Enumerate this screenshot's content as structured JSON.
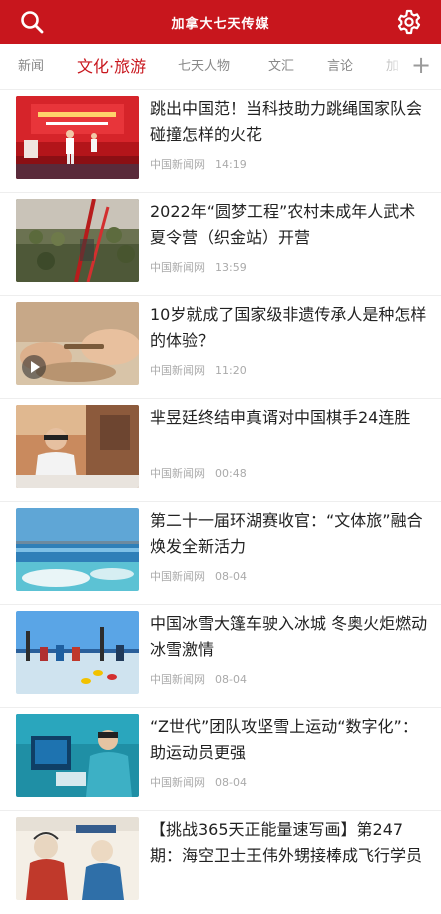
{
  "app": {
    "title": "加拿大七天传媒"
  },
  "header": {
    "search_icon": "search-icon",
    "settings_icon": "gear-icon"
  },
  "tabs": [
    {
      "label": "新闻",
      "active": false
    },
    {
      "label": "文化·旅游",
      "active": true
    },
    {
      "label": "七天人物",
      "active": false
    },
    {
      "label": "文汇",
      "active": false
    },
    {
      "label": "言论",
      "active": false
    },
    {
      "label": "加",
      "active": false
    }
  ],
  "tab_add_label": "+",
  "colors": {
    "brand_red": "#c8161d",
    "meta_gray": "#aaaaaa",
    "headline": "#222222"
  },
  "news": [
    {
      "headline": "跳出中国范！当科技助力跳绳国家队会碰撞怎样的火花",
      "source": "中国新闻网",
      "time": "14:19",
      "has_video": false,
      "thumb": "red-stage-event"
    },
    {
      "headline": "2022年“圆梦工程”农村未成年人武术夏令营（织金站）开营",
      "source": "中国新闻网",
      "time": "13:59",
      "has_video": false,
      "thumb": "martial-arts-camp"
    },
    {
      "headline": "10岁就成了国家级非遗传承人是种怎样的体验？",
      "source": "中国新闻网",
      "time": "11:20",
      "has_video": true,
      "thumb": "craft-hands"
    },
    {
      "headline": "芈昱廷终结申真谞对中国棋手24连胜",
      "source": "中国新闻网",
      "time": "00:48",
      "has_video": false,
      "thumb": "go-player"
    },
    {
      "headline": "第二十一届环湖赛收官：“文体旅”融合焕发全新活力",
      "source": "中国新闻网",
      "time": "08-04",
      "has_video": false,
      "thumb": "lake-shore"
    },
    {
      "headline": "中国冰雪大篷车驶入冰城 冬奥火炬燃动冰雪激情",
      "source": "中国新闻网",
      "time": "08-04",
      "has_video": false,
      "thumb": "curling-event"
    },
    {
      "headline": "“Z世代”团队攻坚雪上运动“数字化”：助运动员更强",
      "source": "中国新闻网",
      "time": "08-04",
      "has_video": false,
      "thumb": "lab-workers"
    },
    {
      "headline": "【挑战365天正能量速写画】第247期：海空卫士王伟外甥接棒成飞行学员",
      "source": "",
      "time": "",
      "has_video": false,
      "thumb": "illustration"
    }
  ]
}
